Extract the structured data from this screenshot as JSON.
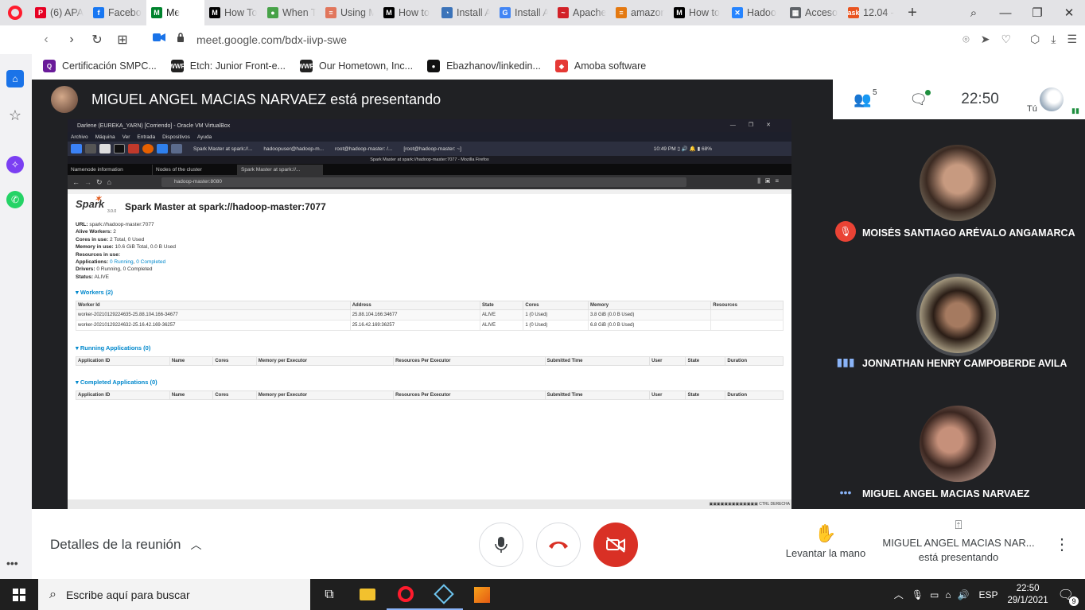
{
  "browser": {
    "tabs": [
      {
        "title": "(6) APA",
        "color": "#e60023",
        "glyph": "P"
      },
      {
        "title": "Facebo",
        "color": "#1877f2",
        "glyph": "f"
      },
      {
        "title": "Me",
        "color": "#00832d",
        "glyph": "M",
        "active": true
      },
      {
        "title": "How To",
        "color": "#000000",
        "glyph": "M"
      },
      {
        "title": "When T",
        "color": "#47a248",
        "glyph": "●"
      },
      {
        "title": "Using M",
        "color": "#e1765c",
        "glyph": "≡"
      },
      {
        "title": "How to",
        "color": "#000000",
        "glyph": "M"
      },
      {
        "title": "Install A",
        "color": "#3b73b9",
        "glyph": "◔"
      },
      {
        "title": "Install A",
        "color": "#4285f4",
        "glyph": "G"
      },
      {
        "title": "Apache",
        "color": "#d22128",
        "glyph": "~"
      },
      {
        "title": "amazon",
        "color": "#e47911",
        "glyph": "≡"
      },
      {
        "title": "How to",
        "color": "#000000",
        "glyph": "M"
      },
      {
        "title": "Hadoo",
        "color": "#2684ff",
        "glyph": "✕"
      },
      {
        "title": "Acceso",
        "color": "#5f6368",
        "glyph": "▦"
      },
      {
        "title": "12.04 -",
        "color": "#e95420",
        "glyph": "ask"
      }
    ],
    "url": "meet.google.com/bdx-iivp-swe",
    "bookmarks": [
      {
        "label": "Certificación SMPC...",
        "color": "#6a1b9a",
        "glyph": "Q"
      },
      {
        "label": "Etch: Junior Front-e...",
        "color": "#222222",
        "glyph": "WWR"
      },
      {
        "label": "Our Hometown, Inc...",
        "color": "#222222",
        "glyph": "WWR"
      },
      {
        "label": "Ebazhanov/linkedin...",
        "color": "#111111",
        "glyph": "●"
      },
      {
        "label": "Amoba software",
        "color": "#e53935",
        "glyph": "◆"
      }
    ]
  },
  "meet": {
    "presenter_title": "MIGUEL ANGEL MACIAS NARVAEZ está presentando",
    "people_count": "5",
    "clock": "22:50",
    "self_label": "Tú",
    "participants": [
      {
        "name": "MOISÉS SANTIAGO ARÉVALO ANGAMARCA",
        "status": "muted"
      },
      {
        "name": "JONNATHAN HENRY CAMPOBERDE AVILA",
        "status": "speaking"
      },
      {
        "name": "MIGUEL ANGEL MACIAS NARVAEZ",
        "status": "more"
      }
    ],
    "details_label": "Detalles de la reunión",
    "raise_hand_label": "Levantar la mano",
    "presenting_name": "MIGUEL ANGEL MACIAS NAR...",
    "presenting_sub": "está presentando"
  },
  "shared_screen": {
    "vbox_title": "Darlene (EUREKA_YARN) [Corriendo] - Oracle VM VirtualBox",
    "vbox_menu": [
      "Archivo",
      "Máquina",
      "Ver",
      "Entrada",
      "Dispositivos",
      "Ayuda"
    ],
    "vm_tasks": [
      "Spark Master at spark://...",
      "hadoopuser@hadoop-m...",
      "root@hadoop-master: /...",
      "[root@hadoop-master: ~]"
    ],
    "vm_clock": "10:49 PM",
    "vm_battery": "68%",
    "ff_title": "Spark Master at spark://hadoop-master:7077 - Mozilla Firefox",
    "ff_tabs": [
      "Namenode information",
      "Nodes of the cluster",
      "Spark Master at spark://..."
    ],
    "ff_url": "hadoop-master:8080",
    "spark": {
      "logo_text": "Spark",
      "version": "3.0.0",
      "title": "Spark Master at spark://hadoop-master:7077",
      "url_label": "URL:",
      "url_value": "spark://hadoop-master:7077",
      "alive_label": "Alive Workers:",
      "alive_value": "2",
      "cores_label": "Cores in use:",
      "cores_value": "2 Total, 0 Used",
      "memory_label": "Memory in use:",
      "memory_value": "10.6 GiB Total, 0.0 B Used",
      "resources_label": "Resources in use:",
      "apps_label": "Applications:",
      "apps_running": "0 Running",
      "apps_completed": "0 Completed",
      "drivers_label": "Drivers:",
      "drivers_value": "0 Running, 0 Completed",
      "status_label": "Status:",
      "status_value": "ALIVE",
      "workers_heading": "▾ Workers (2)",
      "workers_columns": [
        "Worker Id",
        "Address",
        "State",
        "Cores",
        "Memory",
        "Resources"
      ],
      "workers_rows": [
        [
          "worker-20210129224635-25.88.104.166-34677",
          "25.88.104.166:34677",
          "ALIVE",
          "1 (0 Used)",
          "3.8 GiB (0.0 B Used)",
          ""
        ],
        [
          "worker-20210129224632-25.16.42.169-36257",
          "25.16.42.169:36257",
          "ALIVE",
          "1 (0 Used)",
          "6.8 GiB (0.0 B Used)",
          ""
        ]
      ],
      "running_heading": "▾ Running Applications (0)",
      "completed_heading": "▾ Completed Applications (0)",
      "apps_columns": [
        "Application ID",
        "Name",
        "Cores",
        "Memory per Executor",
        "Resources Per Executor",
        "Submitted Time",
        "User",
        "State",
        "Duration"
      ]
    },
    "status_right": "CTRL DERECHA"
  },
  "taskbar": {
    "search_placeholder": "Escribe aquí para buscar",
    "lang": "ESP",
    "time": "22:50",
    "date": "29/1/2021",
    "notifications": "9"
  }
}
